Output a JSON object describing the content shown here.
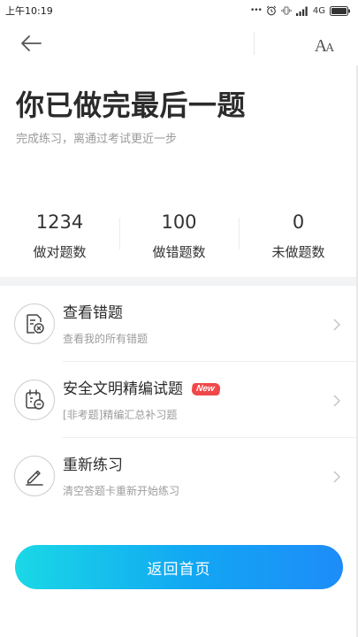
{
  "status_bar": {
    "time": "上午10:19",
    "dots": "•••",
    "network": "4G"
  },
  "nav": {
    "back_icon": "arrow-left-icon",
    "font_icon": "font-size-icon",
    "font_big": "A",
    "font_small": "A"
  },
  "header": {
    "title": "你已做完最后一题",
    "subtitle": "完成练习，离通过考试更近一步"
  },
  "stats": [
    {
      "value": "1234",
      "label": "做对题数"
    },
    {
      "value": "100",
      "label": "做错题数"
    },
    {
      "value": "0",
      "label": "未做题数"
    }
  ],
  "list": [
    {
      "icon": "wrong-questions-icon",
      "title": "查看错题",
      "desc": "查看我的所有错题",
      "badge": ""
    },
    {
      "icon": "calendar-question-icon",
      "title": "安全文明精编试题",
      "desc": "[非考题]精编汇总补习题",
      "badge": "New"
    },
    {
      "icon": "pen-icon",
      "title": "重新练习",
      "desc": "清空答题卡重新开始练习",
      "badge": ""
    }
  ],
  "footer": {
    "home_button_label": "返回首页"
  },
  "colors": {
    "badge": "#f0484a",
    "button_gradient_start": "#1ad8e6",
    "button_gradient_end": "#1e8cf8"
  }
}
